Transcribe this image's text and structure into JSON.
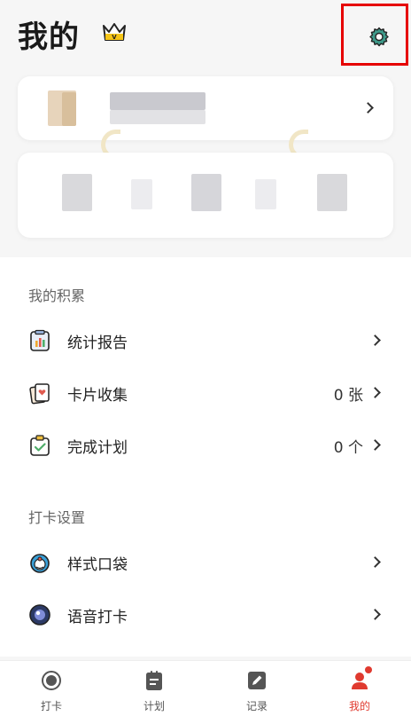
{
  "header": {
    "title": "我的"
  },
  "sections": [
    {
      "title": "我的积累",
      "items": [
        {
          "label": "统计报告",
          "value": ""
        },
        {
          "label": "卡片收集",
          "value": "0 张"
        },
        {
          "label": "完成计划",
          "value": "0 个"
        }
      ]
    },
    {
      "title": "打卡设置",
      "items": [
        {
          "label": "样式口袋",
          "value": ""
        },
        {
          "label": "语音打卡",
          "value": ""
        }
      ]
    }
  ],
  "tabs": [
    {
      "label": "打卡",
      "icon": "record-icon"
    },
    {
      "label": "计划",
      "icon": "clipboard-icon"
    },
    {
      "label": "记录",
      "icon": "edit-icon"
    },
    {
      "label": "我的",
      "icon": "profile-icon",
      "active": true
    }
  ],
  "colors": {
    "accent": "#e03a2f",
    "highlight_border": "#e60000",
    "gear": "#3e9a8a"
  }
}
